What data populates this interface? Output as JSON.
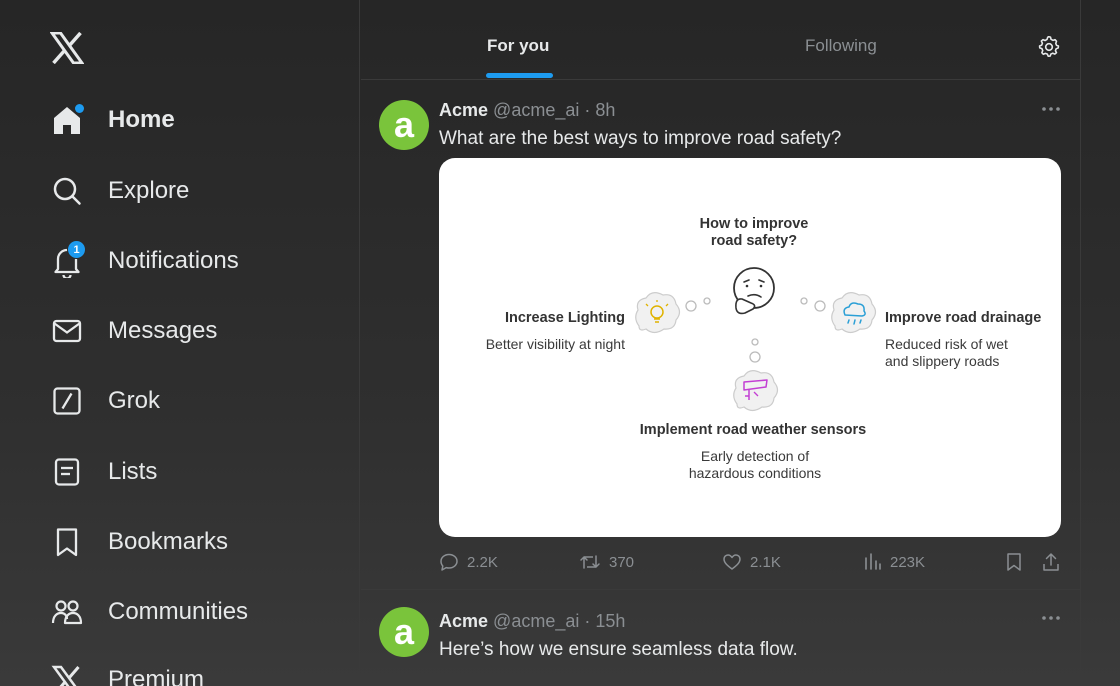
{
  "sidebar": {
    "items": [
      {
        "label": "Home",
        "icon": "home-icon",
        "active": true
      },
      {
        "label": "Explore",
        "icon": "search-icon"
      },
      {
        "label": "Notifications",
        "icon": "bell-icon",
        "badge": "1"
      },
      {
        "label": "Messages",
        "icon": "envelope-icon"
      },
      {
        "label": "Grok",
        "icon": "grok-icon"
      },
      {
        "label": "Lists",
        "icon": "list-icon"
      },
      {
        "label": "Bookmarks",
        "icon": "bookmark-icon"
      },
      {
        "label": "Communities",
        "icon": "communities-icon"
      },
      {
        "label": "Premium",
        "icon": "x-logo-icon"
      }
    ]
  },
  "tabs": {
    "for_you": "For you",
    "following": "Following"
  },
  "posts": [
    {
      "author": "Acme",
      "handle": "@acme_ai",
      "separator": "·",
      "time": "8h",
      "avatar_letter": "a",
      "text": "What are the best ways to improve road safety?",
      "media": {
        "title_line1": "How to improve",
        "title_line2": "road safety?",
        "left_title": "Increase Lighting",
        "left_desc": "Better visibility at night",
        "right_title": "Improve road drainage",
        "right_desc_line1": "Reduced risk of wet",
        "right_desc_line2": "and slippery roads",
        "bottom_title": "Implement road weather sensors",
        "bottom_desc_line1": "Early detection of",
        "bottom_desc_line2": "hazardous conditions"
      },
      "stats": {
        "replies": "2.2K",
        "reposts": "370",
        "likes": "2.1K",
        "views": "223K"
      }
    },
    {
      "author": "Acme",
      "handle": "@acme_ai",
      "separator": "·",
      "time": "15h",
      "avatar_letter": "a",
      "text": "Here’s how we ensure seamless data flow."
    }
  ],
  "colors": {
    "accent": "#1d9bf0",
    "avatar": "#7ac43b",
    "muted": "#8b8f93"
  }
}
